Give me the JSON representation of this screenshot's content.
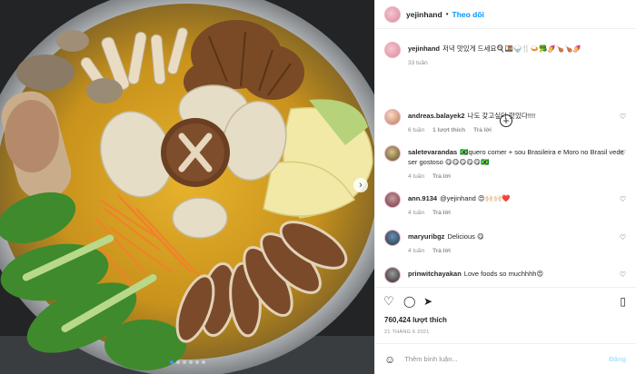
{
  "author": {
    "username": "yejinhand",
    "separator": "•",
    "follow_label": "Theo dõi"
  },
  "caption": {
    "text": "저녁 맛있게 드세요🍳🍱🍚🍴🍛🥦🍠🍗🍗🍠",
    "time": "33 tuần"
  },
  "load_more_icon": "plus-circle-icon",
  "comments": [
    {
      "username": "andreas.balayek2",
      "text": "나도 갖고싶다 맛있다!!!!",
      "time": "6 tuần",
      "likes": "1 lượt thích",
      "reply": "Trả lời"
    },
    {
      "username": "saletevarandas",
      "text": "🇧🇷quero comer + sou Brasileira e Moro no Brasil vede ser gostoso 😋😋😋😋😋🇧🇷",
      "time": "4 tuần",
      "reply": "Trả lời"
    },
    {
      "username": "ann.9134",
      "text": "@yejinhand 😍🙌🏻🙌🏻❤️",
      "time": "4 tuần",
      "reply": "Trả lời"
    },
    {
      "username": "maryuribgz",
      "text": "Delicious 😋",
      "time": "4 tuần",
      "reply": "Trả lời"
    },
    {
      "username": "prinwitchayakan",
      "text": "Love foods so muchhhh😍",
      "time": "",
      "reply": ""
    }
  ],
  "actions": {
    "like_icon": "heart-icon",
    "comment_icon": "comment-icon",
    "share_icon": "send-icon",
    "save_icon": "bookmark-icon"
  },
  "likes_text": "760,424 lượt thích",
  "date_text": "21 THÁNG 6 2021",
  "composer": {
    "placeholder": "Thêm bình luận...",
    "post_label": "Đăng"
  },
  "carousel": {
    "slide_count": 6,
    "active_index": 0
  }
}
